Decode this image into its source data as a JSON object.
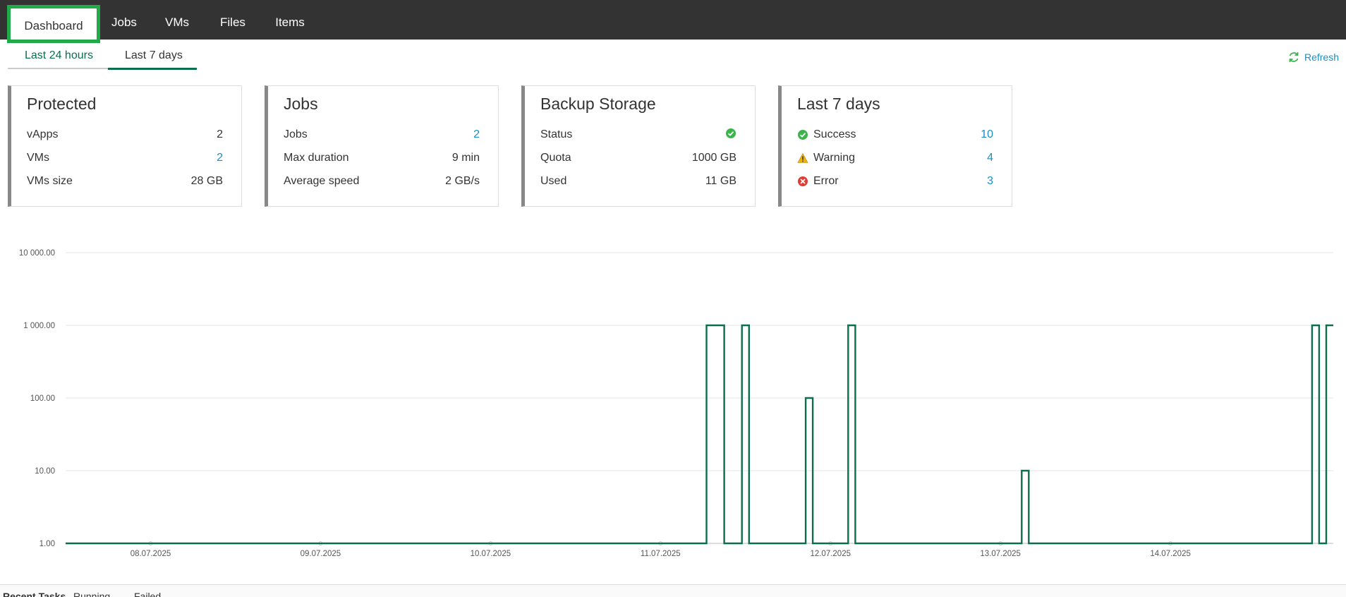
{
  "nav": {
    "tabs": [
      {
        "label": "Dashboard",
        "active": true
      },
      {
        "label": "Jobs"
      },
      {
        "label": "VMs"
      },
      {
        "label": "Files"
      },
      {
        "label": "Items"
      }
    ]
  },
  "period": {
    "tabs": [
      {
        "label": "Last 24 hours"
      },
      {
        "label": "Last 7 days",
        "active": true
      }
    ],
    "refresh_label": "Refresh"
  },
  "cards": {
    "protected": {
      "title": "Protected",
      "rows": [
        {
          "label": "vApps",
          "value": "2"
        },
        {
          "label": "VMs",
          "value": "2"
        },
        {
          "label": "VMs size",
          "value": "28 GB"
        }
      ]
    },
    "jobs": {
      "title": "Jobs",
      "rows": [
        {
          "label": "Jobs",
          "value": "2"
        },
        {
          "label": "Max duration",
          "value": "9 min"
        },
        {
          "label": "Average speed",
          "value": "2 GB/s"
        }
      ]
    },
    "storage": {
      "title": "Backup Storage",
      "rows": [
        {
          "label": "Status",
          "value": ""
        },
        {
          "label": "Quota",
          "value": "1000 GB"
        },
        {
          "label": "Used",
          "value": "11 GB"
        }
      ]
    },
    "last7": {
      "title": "Last 7 days",
      "rows": [
        {
          "label": "Success",
          "value": "10"
        },
        {
          "label": "Warning",
          "value": "4"
        },
        {
          "label": "Error",
          "value": "3"
        }
      ]
    }
  },
  "colors": {
    "accent": "#0b6e4f",
    "link": "#1a8fc2",
    "success": "#3cb44b",
    "warning": "#f0b400",
    "error": "#e03c31",
    "active_tab_border": "#22a94a"
  },
  "icons": {
    "refresh": "refresh-icon",
    "success": "check-circle-icon",
    "warning": "warning-triangle-icon",
    "error": "error-circle-icon"
  },
  "chart_data": {
    "type": "line",
    "scale": "log",
    "ylim": [
      1,
      10000
    ],
    "y_ticks": [
      "10 000.00",
      "1 000.00",
      "100.00",
      "10.00",
      "1.00"
    ],
    "y_tick_values": [
      10000,
      1000,
      100,
      10,
      1
    ],
    "x_range": [
      "07.07.2025 12:00",
      "14.07.2025 23:00"
    ],
    "x_ticks": [
      "08.07.2025",
      "09.07.2025",
      "10.07.2025",
      "11.07.2025",
      "12.07.2025",
      "13.07.2025",
      "14.07.2025"
    ],
    "grid": true,
    "series": [
      {
        "style": "step",
        "points": [
          [
            "07.07.2025 12:00",
            1
          ],
          [
            "11.07.2025 06:30",
            1
          ],
          [
            "11.07.2025 06:30",
            1000
          ],
          [
            "11.07.2025 09:00",
            1000
          ],
          [
            "11.07.2025 09:00",
            1
          ],
          [
            "11.07.2025 11:30",
            1
          ],
          [
            "11.07.2025 11:30",
            1000
          ],
          [
            "11.07.2025 12:30",
            1000
          ],
          [
            "11.07.2025 12:30",
            1
          ],
          [
            "11.07.2025 20:30",
            1
          ],
          [
            "11.07.2025 20:30",
            100
          ],
          [
            "11.07.2025 21:30",
            100
          ],
          [
            "11.07.2025 21:30",
            1
          ],
          [
            "12.07.2025 02:30",
            1
          ],
          [
            "12.07.2025 02:30",
            1000
          ],
          [
            "12.07.2025 03:30",
            1000
          ],
          [
            "12.07.2025 03:30",
            1
          ],
          [
            "13.07.2025 03:00",
            1
          ],
          [
            "13.07.2025 03:00",
            10
          ],
          [
            "13.07.2025 04:00",
            10
          ],
          [
            "13.07.2025 04:00",
            1
          ],
          [
            "14.07.2025 20:00",
            1
          ],
          [
            "14.07.2025 20:00",
            1000
          ],
          [
            "14.07.2025 21:00",
            1000
          ],
          [
            "14.07.2025 21:00",
            1
          ],
          [
            "14.07.2025 22:00",
            1
          ],
          [
            "14.07.2025 22:00",
            1000
          ],
          [
            "14.07.2025 23:00",
            1000
          ]
        ]
      }
    ]
  },
  "bottom": {
    "title": "Recent Tasks",
    "legend_running": "Running",
    "legend_failed": "Failed"
  }
}
